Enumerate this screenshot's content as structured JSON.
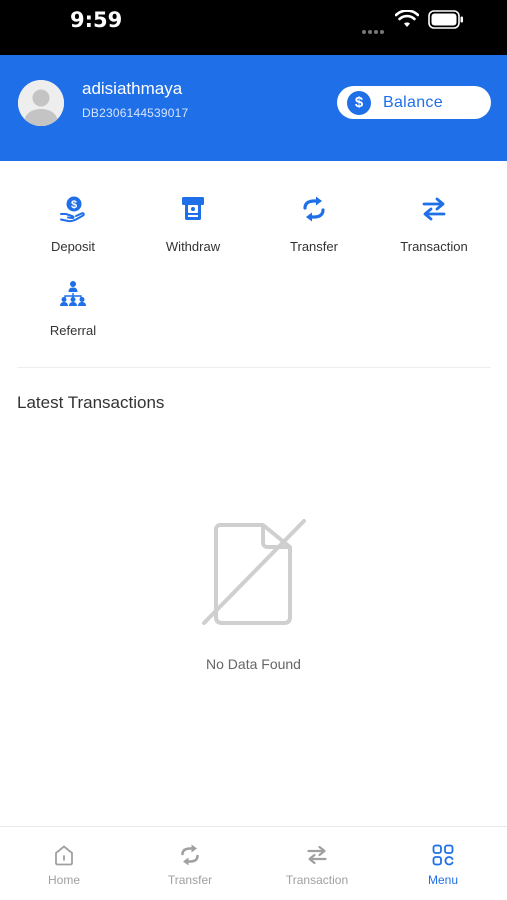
{
  "status_bar": {
    "time": "9:59"
  },
  "header": {
    "username": "adisiathmaya",
    "account_id": "DB2306144539017",
    "balance_label": "Balance",
    "balance_icon": "$"
  },
  "actions": [
    {
      "label": "Deposit",
      "icon": "deposit-icon"
    },
    {
      "label": "Withdraw",
      "icon": "atm-icon"
    },
    {
      "label": "Transfer",
      "icon": "transfer-icon"
    },
    {
      "label": "Transaction",
      "icon": "swap-arrows-icon"
    },
    {
      "label": "Referral",
      "icon": "referral-network-icon"
    }
  ],
  "transactions": {
    "title": "Latest Transactions",
    "empty_text": "No Data Found"
  },
  "bottom_nav": [
    {
      "label": "Home",
      "icon": "home-icon",
      "active": false
    },
    {
      "label": "Transfer",
      "icon": "transfer-icon",
      "active": false
    },
    {
      "label": "Transaction",
      "icon": "swap-arrows-icon",
      "active": false
    },
    {
      "label": "Menu",
      "icon": "grid-menu-icon",
      "active": true
    }
  ],
  "colors": {
    "primary": "#1f6fe8",
    "inactive": "#a0a0a0"
  }
}
